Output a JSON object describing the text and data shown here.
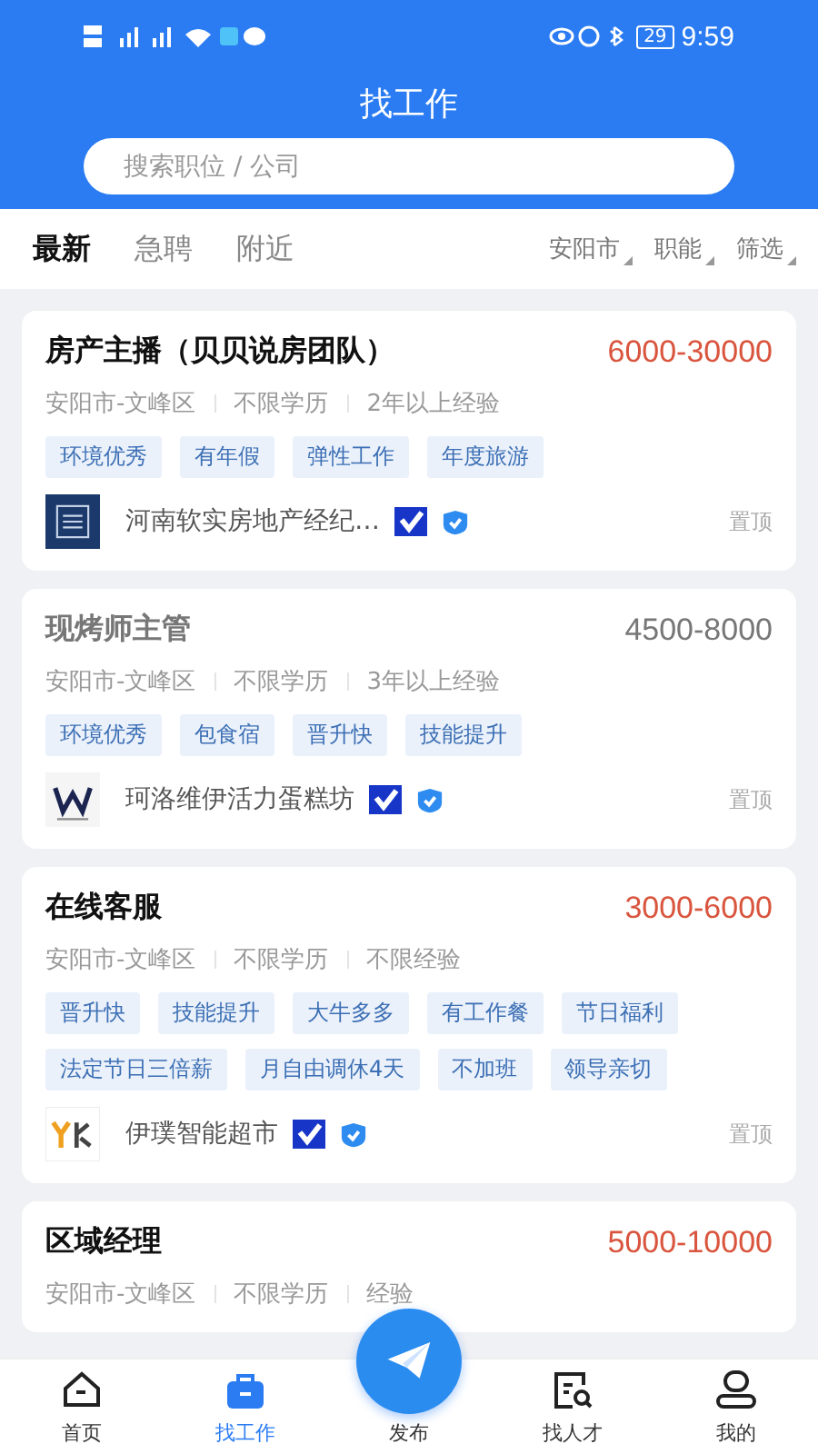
{
  "status_bar": {
    "battery": "29",
    "time": "9:59"
  },
  "header": {
    "title": "找工作"
  },
  "search": {
    "placeholder": "搜索职位 / 公司"
  },
  "tabs": [
    {
      "label": "最新",
      "selected": true
    },
    {
      "label": "急聘",
      "selected": false
    },
    {
      "label": "附近",
      "selected": false
    }
  ],
  "filters": [
    "安阳市",
    "职能",
    "筛选"
  ],
  "jobs": [
    {
      "title": "房产主播（贝贝说房团队）",
      "salary": "6000-30000",
      "viewed": false,
      "meta": [
        "安阳市-文峰区",
        "不限学历",
        "2年以上经验"
      ],
      "tags": [
        "环境优秀",
        "有年假",
        "弹性工作",
        "年度旅游"
      ],
      "company": "河南软实房地产经纪…",
      "logo": {
        "kind": "square"
      },
      "pin": "置顶"
    },
    {
      "title": "现烤师主管",
      "salary": "4500-8000",
      "viewed": true,
      "meta": [
        "安阳市-文峰区",
        "不限学历",
        "3年以上经验"
      ],
      "tags": [
        "环境优秀",
        "包食宿",
        "晋升快",
        "技能提升"
      ],
      "company": "珂洛维伊活力蛋糕坊",
      "logo": {
        "kind": "crest"
      },
      "pin": "置顶"
    },
    {
      "title": "在线客服",
      "salary": "3000-6000",
      "viewed": false,
      "meta": [
        "安阳市-文峰区",
        "不限学历",
        "不限经验"
      ],
      "tags": [
        "晋升快",
        "技能提升",
        "大牛多多",
        "有工作餐",
        "节日福利",
        "法定节日三倍薪",
        "月自由调休4天",
        "不加班",
        "领导亲切"
      ],
      "company": "伊璞智能超市",
      "logo": {
        "kind": "mark"
      },
      "pin": "置顶"
    },
    {
      "title": "区域经理",
      "salary": "5000-10000",
      "viewed": false,
      "meta": [
        "安阳市-文峰区",
        "不限学历",
        "经验"
      ]
    }
  ],
  "nav": [
    {
      "label": "首页",
      "kind": "home",
      "selected": false
    },
    {
      "label": "找工作",
      "kind": "bag",
      "selected": true
    },
    {
      "label": "发布",
      "kind": "publish",
      "selected": false
    },
    {
      "label": "找人才",
      "kind": "talent",
      "selected": false
    },
    {
      "label": "我的",
      "kind": "me",
      "selected": false
    }
  ]
}
